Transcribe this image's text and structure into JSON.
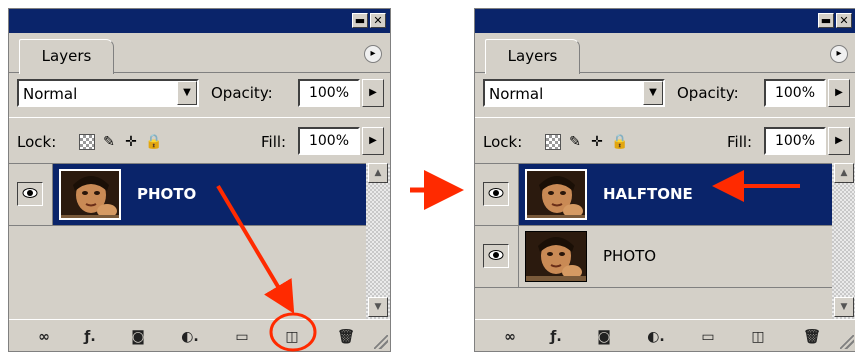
{
  "colors": {
    "panel_bg": "#d4d0c8",
    "title_bg": "#0a246a",
    "selected_row": "#0a246a",
    "annotation": "#ff2a00"
  },
  "window_buttons": {
    "minimize": "▬",
    "close": "✕"
  },
  "left_panel": {
    "tab_label": "Layers",
    "blend_mode": "Normal",
    "opacity_label": "Opacity:",
    "opacity_value": "100%",
    "lock_label": "Lock:",
    "fill_label": "Fill:",
    "fill_value": "100%",
    "layers": [
      {
        "name": "PHOTO",
        "selected": true,
        "visible": true
      }
    ]
  },
  "right_panel": {
    "tab_label": "Layers",
    "blend_mode": "Normal",
    "opacity_label": "Opacity:",
    "opacity_value": "100%",
    "lock_label": "Lock:",
    "fill_label": "Fill:",
    "fill_value": "100%",
    "layers": [
      {
        "name": "HALFTONE",
        "selected": true,
        "visible": true
      },
      {
        "name": "PHOTO",
        "selected": false,
        "visible": true
      }
    ]
  },
  "bottom_icons": [
    "link-icon",
    "layer-style-icon",
    "layer-mask-icon",
    "adjustment-layer-icon",
    "new-group-icon",
    "new-layer-icon",
    "trash-icon"
  ],
  "annotations": {
    "left_arrow_target": "new-layer-button",
    "right_arrow_target": "layer-row-halftone",
    "transition_arrow": "right"
  }
}
